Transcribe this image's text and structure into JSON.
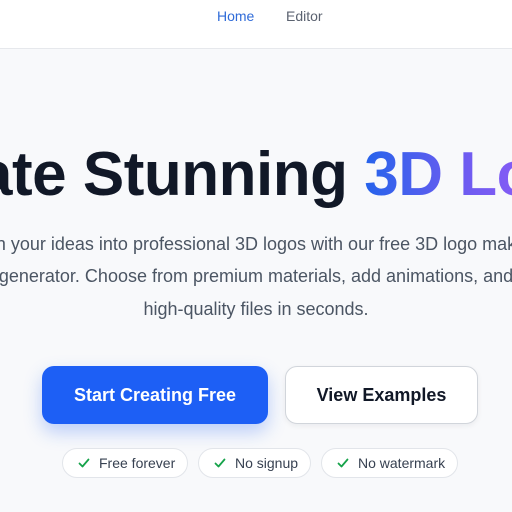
{
  "nav": {
    "home_label": "Home",
    "editor_label": "Editor"
  },
  "hero": {
    "title_main": "ate Stunning ",
    "title_accent": "3D Lo",
    "subtitle_line1": "n your ideas into professional 3D logos with our free 3D logo mak",
    "subtitle_line2": "generator. Choose from premium materials, add animations, and",
    "subtitle_line3": "high-quality files in seconds."
  },
  "cta": {
    "primary_label": "Start Creating Free",
    "secondary_label": "View Examples"
  },
  "features": [
    {
      "label": "Free forever",
      "icon": "check-icon"
    },
    {
      "label": "No signup",
      "icon": "check-icon"
    },
    {
      "label": "No watermark",
      "icon": "check-icon"
    }
  ],
  "colors": {
    "accent_blue": "#1d5ff5",
    "accent_gradient_start": "#2563eb",
    "accent_gradient_end": "#8b5cf6",
    "check_green": "#16a34a",
    "nav_active": "#2f6bd8"
  }
}
